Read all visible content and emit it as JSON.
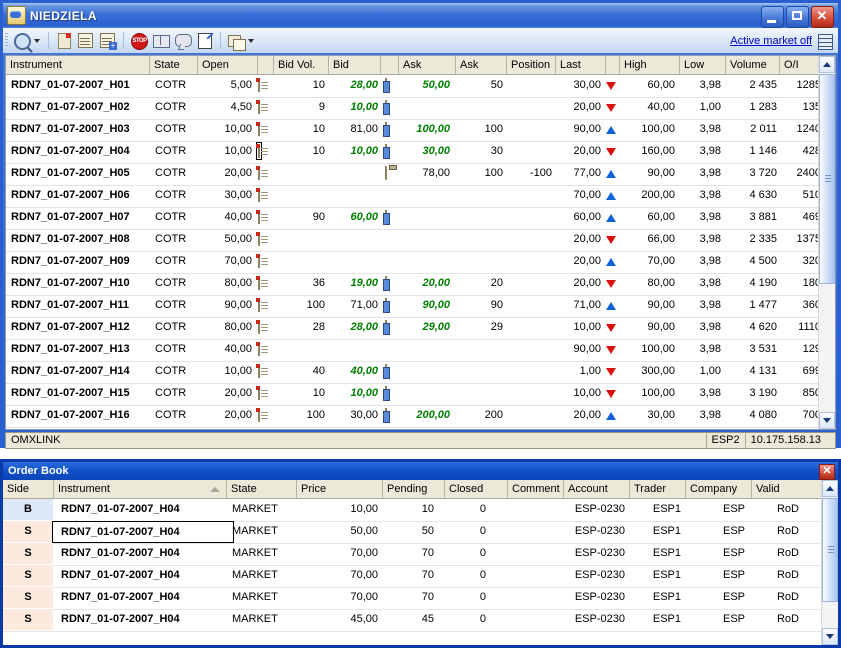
{
  "main_window": {
    "title": "NIEDZIELA",
    "title_icon": "app-globe-icon",
    "window_buttons": {
      "minimize": "_",
      "maximize": "▫",
      "close": "✕"
    },
    "toolbar": {
      "items": [
        {
          "name": "search-icon",
          "label": ""
        },
        {
          "name": "dropdown-caret-icon",
          "label": ""
        },
        {
          "name": "new-order-icon",
          "label": ""
        },
        {
          "name": "order-list-icon",
          "label": ""
        },
        {
          "name": "add-order-icon",
          "label": ""
        },
        {
          "name": "stop-icon",
          "label": "STOP"
        },
        {
          "name": "order-book-icon",
          "label": ""
        },
        {
          "name": "message-icon",
          "label": ""
        },
        {
          "name": "edit-icon",
          "label": ""
        },
        {
          "name": "copy-sheets-icon",
          "label": ""
        },
        {
          "name": "dropdown-caret-icon",
          "label": ""
        }
      ],
      "active_market_link": "Active market off",
      "grid-view-icon": ""
    },
    "columns": [
      {
        "key": "instrument",
        "label": "Instrument"
      },
      {
        "key": "state",
        "label": "State"
      },
      {
        "key": "open",
        "label": "Open"
      },
      {
        "key": "open_icon",
        "label": ""
      },
      {
        "key": "bid_vol",
        "label": "Bid Vol."
      },
      {
        "key": "bid",
        "label": "Bid"
      },
      {
        "key": "bid_icon",
        "label": ""
      },
      {
        "key": "ask",
        "label": "Ask"
      },
      {
        "key": "ask_vol",
        "label": "Ask"
      },
      {
        "key": "position",
        "label": "Position"
      },
      {
        "key": "last",
        "label": "Last"
      },
      {
        "key": "trend",
        "label": ""
      },
      {
        "key": "high",
        "label": "High"
      },
      {
        "key": "low",
        "label": "Low"
      },
      {
        "key": "volume",
        "label": "Volume"
      },
      {
        "key": "oi",
        "label": "O/I"
      }
    ],
    "rows": [
      {
        "instrument": "RDN7_01-07-2007_H01",
        "state": "COTR",
        "open": "5,00",
        "open_icon": "note-icon",
        "bid_vol": "10",
        "bid": "28,00",
        "bid_style": "green",
        "bid_icon": "blue-note-icon",
        "ask": "50,00",
        "ask_style": "green",
        "ask_vol": "50",
        "position": "",
        "last": "30,00",
        "trend": "down",
        "high": "60,00",
        "low": "3,98",
        "volume": "2 435",
        "oi": "1285"
      },
      {
        "instrument": "RDN7_01-07-2007_H02",
        "state": "COTR",
        "open": "4,50",
        "open_icon": "note-icon",
        "bid_vol": "9",
        "bid": "10,00",
        "bid_style": "green",
        "bid_icon": "blue-note-icon",
        "ask": "",
        "ask_style": "green",
        "ask_vol": "",
        "position": "",
        "last": "20,00",
        "trend": "down",
        "high": "40,00",
        "low": "1,00",
        "volume": "1 283",
        "oi": "135"
      },
      {
        "instrument": "RDN7_01-07-2007_H03",
        "state": "COTR",
        "open": "10,00",
        "open_icon": "note-icon",
        "bid_vol": "10",
        "bid": "81,00",
        "bid_style": "black",
        "bid_icon": "blue-note-icon",
        "ask": "100,00",
        "ask_style": "green",
        "ask_vol": "100",
        "position": "",
        "last": "90,00",
        "trend": "up",
        "high": "100,00",
        "low": "3,98",
        "volume": "2 011",
        "oi": "1240"
      },
      {
        "instrument": "RDN7_01-07-2007_H04",
        "state": "COTR",
        "open": "10,00",
        "open_icon": "note-icon-selected",
        "bid_vol": "10",
        "bid": "10,00",
        "bid_style": "green",
        "bid_icon": "blue-note-icon",
        "ask": "30,00",
        "ask_style": "green",
        "ask_vol": "30",
        "position": "",
        "last": "20,00",
        "trend": "down",
        "high": "160,00",
        "low": "3,98",
        "volume": "1 146",
        "oi": "428"
      },
      {
        "instrument": "RDN7_01-07-2007_H05",
        "state": "COTR",
        "open": "20,00",
        "open_icon": "note-icon",
        "bid_vol": "",
        "bid": "",
        "bid_style": "black",
        "bid_icon": "clipboard-icon",
        "ask": "78,00",
        "ask_style": "black",
        "ask_vol": "100",
        "position": "-100",
        "last": "77,00",
        "trend": "up",
        "high": "90,00",
        "low": "3,98",
        "volume": "3 720",
        "oi": "2400"
      },
      {
        "instrument": "RDN7_01-07-2007_H06",
        "state": "COTR",
        "open": "30,00",
        "open_icon": "note-icon",
        "bid_vol": "",
        "bid": "",
        "bid_style": "black",
        "bid_icon": "",
        "ask": "",
        "ask_style": "black",
        "ask_vol": "",
        "position": "",
        "last": "70,00",
        "trend": "up",
        "high": "200,00",
        "low": "3,98",
        "volume": "4 630",
        "oi": "510"
      },
      {
        "instrument": "RDN7_01-07-2007_H07",
        "state": "COTR",
        "open": "40,00",
        "open_icon": "note-icon",
        "bid_vol": "90",
        "bid": "60,00",
        "bid_style": "green",
        "bid_icon": "blue-note-icon",
        "ask": "",
        "ask_style": "black",
        "ask_vol": "",
        "position": "",
        "last": "60,00",
        "trend": "up",
        "high": "60,00",
        "low": "3,98",
        "volume": "3 881",
        "oi": "469"
      },
      {
        "instrument": "RDN7_01-07-2007_H08",
        "state": "COTR",
        "open": "50,00",
        "open_icon": "note-icon",
        "bid_vol": "",
        "bid": "",
        "bid_style": "black",
        "bid_icon": "",
        "ask": "",
        "ask_style": "black",
        "ask_vol": "",
        "position": "",
        "last": "20,00",
        "trend": "down",
        "high": "66,00",
        "low": "3,98",
        "volume": "2 335",
        "oi": "1375"
      },
      {
        "instrument": "RDN7_01-07-2007_H09",
        "state": "COTR",
        "open": "70,00",
        "open_icon": "note-icon",
        "bid_vol": "",
        "bid": "",
        "bid_style": "black",
        "bid_icon": "",
        "ask": "",
        "ask_style": "black",
        "ask_vol": "",
        "position": "",
        "last": "20,00",
        "trend": "up",
        "high": "70,00",
        "low": "3,98",
        "volume": "4 500",
        "oi": "320"
      },
      {
        "instrument": "RDN7_01-07-2007_H10",
        "state": "COTR",
        "open": "80,00",
        "open_icon": "note-icon",
        "bid_vol": "36",
        "bid": "19,00",
        "bid_style": "green",
        "bid_icon": "blue-note-icon",
        "ask": "20,00",
        "ask_style": "green",
        "ask_vol": "20",
        "position": "",
        "last": "20,00",
        "trend": "down",
        "high": "80,00",
        "low": "3,98",
        "volume": "4 190",
        "oi": "180"
      },
      {
        "instrument": "RDN7_01-07-2007_H11",
        "state": "COTR",
        "open": "90,00",
        "open_icon": "note-icon",
        "bid_vol": "100",
        "bid": "71,00",
        "bid_style": "black",
        "bid_icon": "blue-note-icon",
        "ask": "90,00",
        "ask_style": "green",
        "ask_vol": "90",
        "position": "",
        "last": "71,00",
        "trend": "up",
        "high": "90,00",
        "low": "3,98",
        "volume": "1 477",
        "oi": "360"
      },
      {
        "instrument": "RDN7_01-07-2007_H12",
        "state": "COTR",
        "open": "80,00",
        "open_icon": "note-icon",
        "bid_vol": "28",
        "bid": "28,00",
        "bid_style": "green",
        "bid_icon": "blue-note-icon",
        "ask": "29,00",
        "ask_style": "green",
        "ask_vol": "29",
        "position": "",
        "last": "10,00",
        "trend": "down",
        "high": "90,00",
        "low": "3,98",
        "volume": "4 620",
        "oi": "1110"
      },
      {
        "instrument": "RDN7_01-07-2007_H13",
        "state": "COTR",
        "open": "40,00",
        "open_icon": "note-icon",
        "bid_vol": "",
        "bid": "",
        "bid_style": "black",
        "bid_icon": "",
        "ask": "",
        "ask_style": "black",
        "ask_vol": "",
        "position": "",
        "last": "90,00",
        "trend": "down",
        "high": "100,00",
        "low": "3,98",
        "volume": "3 531",
        "oi": "129"
      },
      {
        "instrument": "RDN7_01-07-2007_H14",
        "state": "COTR",
        "open": "10,00",
        "open_icon": "note-icon",
        "bid_vol": "40",
        "bid": "40,00",
        "bid_style": "green",
        "bid_icon": "blue-note-icon",
        "ask": "",
        "ask_style": "black",
        "ask_vol": "",
        "position": "",
        "last": "1,00",
        "trend": "down",
        "high": "300,00",
        "low": "1,00",
        "volume": "4 131",
        "oi": "699"
      },
      {
        "instrument": "RDN7_01-07-2007_H15",
        "state": "COTR",
        "open": "20,00",
        "open_icon": "note-icon",
        "bid_vol": "10",
        "bid": "10,00",
        "bid_style": "green",
        "bid_icon": "blue-note-icon",
        "ask": "",
        "ask_style": "black",
        "ask_vol": "",
        "position": "",
        "last": "10,00",
        "trend": "down",
        "high": "100,00",
        "low": "3,98",
        "volume": "3 190",
        "oi": "850"
      },
      {
        "instrument": "RDN7_01-07-2007_H16",
        "state": "COTR",
        "open": "20,00",
        "open_icon": "note-icon",
        "bid_vol": "100",
        "bid": "30,00",
        "bid_style": "black",
        "bid_icon": "blue-note-icon",
        "ask": "200,00",
        "ask_style": "green",
        "ask_vol": "200",
        "position": "",
        "last": "20,00",
        "trend": "up",
        "high": "30,00",
        "low": "3,98",
        "volume": "4 080",
        "oi": "700"
      }
    ],
    "statusbar": {
      "left": "OMXLINK",
      "segment2": "ESP2",
      "segment3": "10.175.158.13"
    }
  },
  "order_book": {
    "title": "Order Book",
    "close_label": "✕",
    "sorted_column": "Instrument",
    "sort_direction": "asc",
    "columns": [
      {
        "key": "side",
        "label": "Side"
      },
      {
        "key": "instrument",
        "label": "Instrument"
      },
      {
        "key": "state",
        "label": "State"
      },
      {
        "key": "price",
        "label": "Price"
      },
      {
        "key": "pending",
        "label": "Pending"
      },
      {
        "key": "closed",
        "label": "Closed"
      },
      {
        "key": "comment",
        "label": "Comment"
      },
      {
        "key": "account",
        "label": "Account"
      },
      {
        "key": "trader",
        "label": "Trader"
      },
      {
        "key": "company",
        "label": "Company"
      },
      {
        "key": "valid",
        "label": "Valid"
      }
    ],
    "rows": [
      {
        "side": "B",
        "instrument": "RDN7_01-07-2007_H04",
        "state": "MARKET",
        "price": "10,00",
        "pending": "10",
        "closed": "0",
        "comment": "",
        "account": "ESP-0230",
        "trader": "ESP1",
        "company": "ESP",
        "valid": "RoD",
        "selected": false
      },
      {
        "side": "S",
        "instrument": "RDN7_01-07-2007_H04",
        "state": "MARKET",
        "price": "50,00",
        "pending": "50",
        "closed": "0",
        "comment": "",
        "account": "ESP-0230",
        "trader": "ESP1",
        "company": "ESP",
        "valid": "RoD",
        "selected": true
      },
      {
        "side": "S",
        "instrument": "RDN7_01-07-2007_H04",
        "state": "MARKET",
        "price": "70,00",
        "pending": "70",
        "closed": "0",
        "comment": "",
        "account": "ESP-0230",
        "trader": "ESP1",
        "company": "ESP",
        "valid": "RoD",
        "selected": false
      },
      {
        "side": "S",
        "instrument": "RDN7_01-07-2007_H04",
        "state": "MARKET",
        "price": "70,00",
        "pending": "70",
        "closed": "0",
        "comment": "",
        "account": "ESP-0230",
        "trader": "ESP1",
        "company": "ESP",
        "valid": "RoD",
        "selected": false
      },
      {
        "side": "S",
        "instrument": "RDN7_01-07-2007_H04",
        "state": "MARKET",
        "price": "70,00",
        "pending": "70",
        "closed": "0",
        "comment": "",
        "account": "ESP-0230",
        "trader": "ESP1",
        "company": "ESP",
        "valid": "RoD",
        "selected": false
      },
      {
        "side": "S",
        "instrument": "RDN7_01-07-2007_H04",
        "state": "MARKET",
        "price": "45,00",
        "pending": "45",
        "closed": "0",
        "comment": "",
        "account": "ESP-0230",
        "trader": "ESP1",
        "company": "ESP",
        "valid": "RoD",
        "selected": false
      }
    ]
  },
  "colors": {
    "accent_blue": "#2a5fd0",
    "bid_green": "#008000",
    "up_blue": "#1060d8",
    "down_red": "#d81010",
    "header_beige": "#ece9d8",
    "side_buy_bg": "#dce8f8",
    "side_sell_bg": "#fceade"
  }
}
